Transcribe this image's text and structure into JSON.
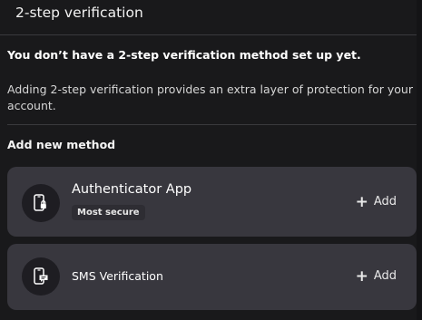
{
  "header": {
    "title": "2-step verification"
  },
  "notice": "You don’t have a 2-step verification method set up yet.",
  "description": "Adding 2-step verification provides an extra layer of protection for your account.",
  "section_title": "Add new method",
  "methods": [
    {
      "name": "Authenticator App",
      "badge": "Most secure",
      "icon": "phone-lock-icon",
      "add_label": "Add",
      "add_icon": "plus-icon"
    },
    {
      "name": "SMS Verification",
      "icon": "phone-message-icon",
      "add_label": "Add",
      "add_icon": "plus-icon"
    }
  ],
  "colors": {
    "background": "#19191b",
    "card": "#38373e",
    "icon_circle": "#1e1d22",
    "divider": "#3a3a3d"
  }
}
